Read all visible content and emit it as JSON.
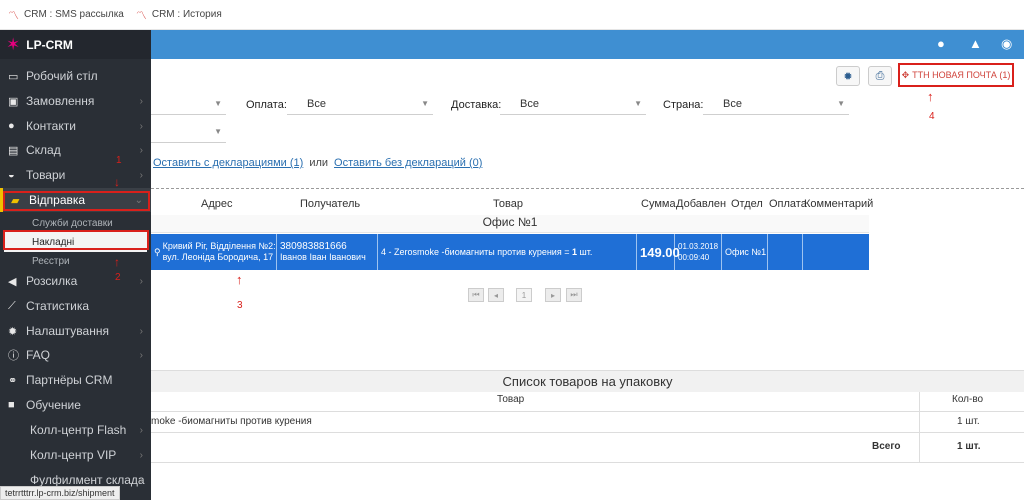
{
  "browser_tabs": [
    {
      "label": "CRM : SMS рассылка"
    },
    {
      "label": "CRM : История"
    }
  ],
  "logo": {
    "text": "LP-CRM"
  },
  "sidebar": {
    "items": [
      {
        "label": "Робочий стіл",
        "icon": "monitor-icon"
      },
      {
        "label": "Замовлення",
        "icon": "money-icon"
      },
      {
        "label": "Контакти",
        "icon": "users-icon"
      },
      {
        "label": "Склад",
        "icon": "archive-icon"
      },
      {
        "label": "Товари",
        "icon": "inbox-icon"
      },
      {
        "label": "Відправка",
        "icon": "truck-icon"
      },
      {
        "label": "Розсилка",
        "icon": "megaphone-icon"
      },
      {
        "label": "Статистика",
        "icon": "chart-icon"
      },
      {
        "label": "Налаштування",
        "icon": "gear-icon"
      },
      {
        "label": "FAQ",
        "icon": "info-icon"
      },
      {
        "label": "Партнёры CRM",
        "icon": "handshake-icon"
      },
      {
        "label": "Обучение",
        "icon": "video-icon"
      },
      {
        "label": "Колл-центр Flash",
        "icon": ""
      },
      {
        "label": "Колл-центр VIP",
        "icon": ""
      },
      {
        "label": "Фулфилмент склада",
        "icon": ""
      }
    ],
    "sub_items": [
      {
        "label": "Служби доставки"
      },
      {
        "label": "Накладні"
      },
      {
        "label": "Реєстри"
      }
    ]
  },
  "toolbar": {
    "ttn_label": "ТТН НОВАЯ ПОЧТА (1)"
  },
  "filters": {
    "payment_label": "Оплата:",
    "payment_value": "Все",
    "delivery_label": "Доставка:",
    "delivery_value": "Все",
    "country_label": "Страна:",
    "country_value": "Все"
  },
  "links": {
    "with_decl": "Оставить с декларациями (1)",
    "or": "или",
    "without_decl": "Оставить без деклараций (0)"
  },
  "table": {
    "headers": [
      "Адрес",
      "Получатель",
      "Товар",
      "Сумма",
      "Добавлен",
      "Отдел",
      "Оплата",
      "Комментарий"
    ],
    "group": "Офис №1",
    "row": {
      "address": "Кривий Ріг, Відділення №2: вул. Леоніда Бородича, 17",
      "recipient_phone": "380983881666",
      "recipient_name": "Іванов Іван Іванович",
      "product_prefix": "4 - Zerosmoke -биомагниты против курения =",
      "product_qty": "1",
      "product_suffix": "шт.",
      "sum": "149.00",
      "added_date": "01.03.2018",
      "added_time": "00:09:40",
      "department": "Офис №1"
    }
  },
  "pager": {
    "page": "1"
  },
  "annotations": [
    "1",
    "2",
    "3",
    "4"
  ],
  "packing": {
    "title": "Список товаров на упаковку",
    "col_product": "Товар",
    "col_qty": "Кол-во",
    "row_product": "moke -биомагниты против курения",
    "row_qty": "1 шт.",
    "total_label": "Всего",
    "total_qty": "1 шт."
  },
  "status_bar": {
    "url": "tetrrtttrr.lp-crm.biz/shipment"
  },
  "colors": {
    "topbar": "#3f8fd2",
    "sidebar": "#2a2f36",
    "selected_row": "#1f6fd6",
    "annotation": "#d9201b"
  }
}
